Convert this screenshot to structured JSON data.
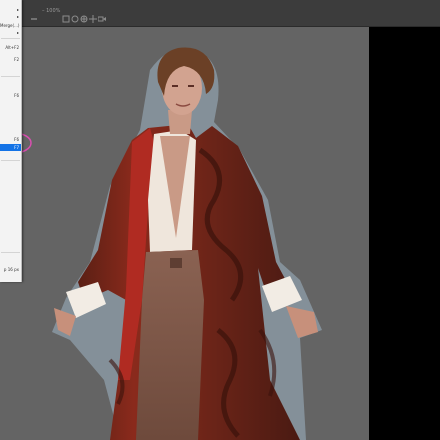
{
  "options_bar": {
    "hint_text": "– 100%",
    "icons": [
      "chevron-icon",
      "align-icon",
      "target-icon",
      "globe-icon",
      "move-icon",
      "video-icon"
    ]
  },
  "context_menu": {
    "items": [
      {
        "label": "",
        "submenu": true
      },
      {
        "label": "",
        "submenu": true
      },
      {
        "label": "Merge(...)"
      },
      {
        "label": "",
        "submenu": true
      },
      {
        "label": "Alt+F2"
      },
      {
        "label": "F2"
      },
      {
        "label": "F6"
      },
      {
        "label": "F6"
      },
      {
        "label": "F7",
        "selected": true
      },
      {
        "label": "p 16 px"
      }
    ]
  },
  "colors": {
    "menu_highlight": "#1473e6",
    "annotation_circle": "#d94fb0",
    "canvas": "#646464",
    "app_bar": "#3c3c3c"
  }
}
